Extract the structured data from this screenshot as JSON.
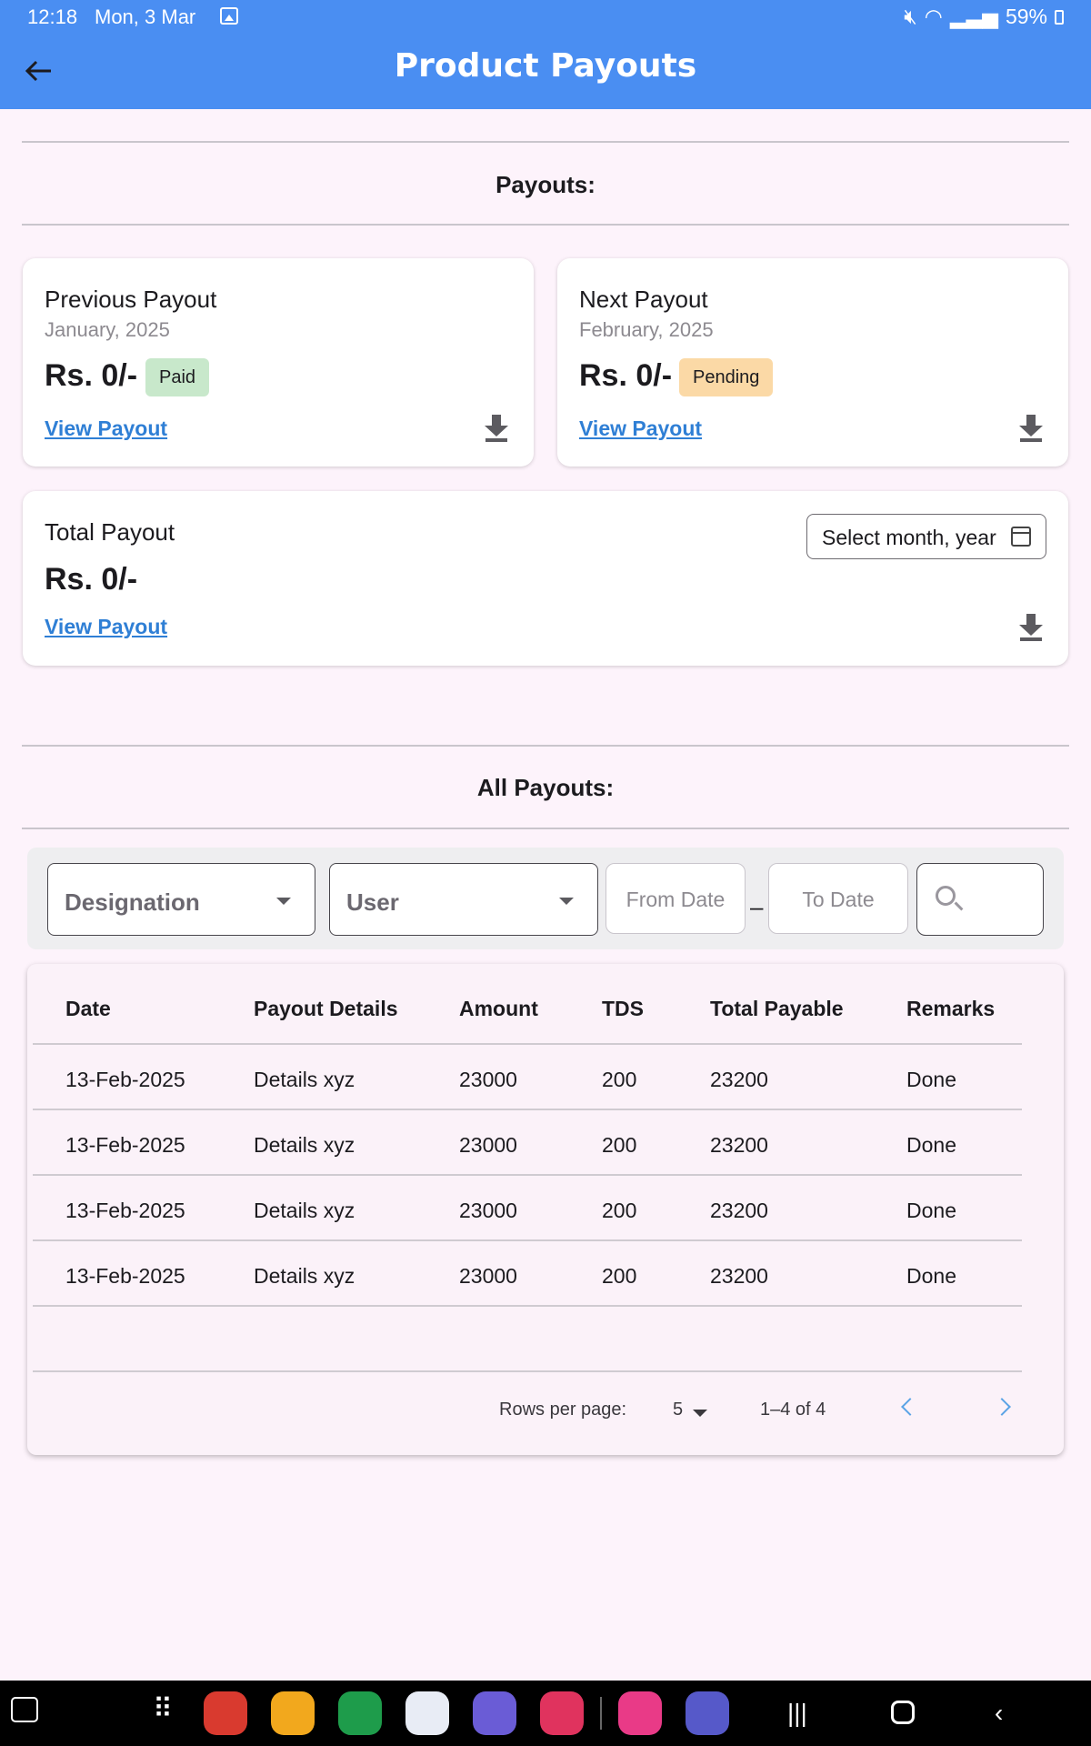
{
  "status_bar": {
    "time": "12:18",
    "date": "Mon, 3 Mar",
    "battery": "59%"
  },
  "header": {
    "title": "Product Payouts"
  },
  "payouts_section": {
    "title": "Payouts:"
  },
  "previous_payout": {
    "title": "Previous Payout",
    "period": "January, 2025",
    "amount": "Rs. 0/-",
    "status": "Paid",
    "link": "View Payout"
  },
  "next_payout": {
    "title": "Next Payout",
    "period": "February, 2025",
    "amount": "Rs. 0/-",
    "status": "Pending",
    "link": "View Payout"
  },
  "total_payout": {
    "title": "Total Payout",
    "amount": "Rs. 0/-",
    "link": "View Payout",
    "month_picker": "Select month, year"
  },
  "all_payouts": {
    "title": "All Payouts:"
  },
  "filters": {
    "designation": "Designation",
    "user": "User",
    "from_date": "From Date",
    "to_date": "To Date",
    "separator": "–"
  },
  "table": {
    "headers": [
      "Date",
      "Payout Details",
      "Amount",
      "TDS",
      "Total Payable",
      "Remarks"
    ],
    "rows": [
      [
        "13-Feb-2025",
        "Details xyz",
        "23000",
        "200",
        "23200",
        "Done"
      ],
      [
        "13-Feb-2025",
        "Details xyz",
        "23000",
        "200",
        "23200",
        "Done"
      ],
      [
        "13-Feb-2025",
        "Details xyz",
        "23000",
        "200",
        "23200",
        "Done"
      ],
      [
        "13-Feb-2025",
        "Details xyz",
        "23000",
        "200",
        "23200",
        "Done"
      ]
    ],
    "rows_per_page_label": "Rows per page:",
    "rows_per_page": "5",
    "range": "1–4 of 4"
  },
  "colors": {
    "primary": "#4a8ef2",
    "background": "#fdf3fb",
    "link": "#2f7fd5",
    "paid_badge": "#c8e8cb",
    "pending_badge": "#fbd9a6"
  }
}
